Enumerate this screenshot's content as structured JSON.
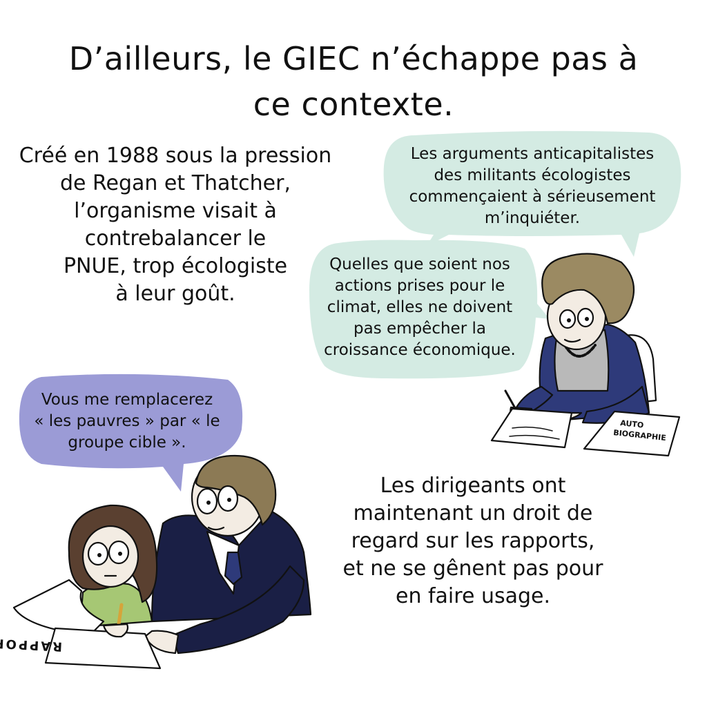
{
  "title": {
    "line1": "D’ailleurs, le GIEC n’échappe pas à",
    "line2": "ce contexte."
  },
  "narration_top": {
    "lines": [
      "Créé en 1988 sous la pression",
      "de Regan et Thatcher,",
      "l’organisme visait à",
      "contrebalancer le",
      "PNUE, trop écologiste",
      "à leur goût."
    ]
  },
  "bubble_thatcher_1": {
    "lines": [
      "Les arguments anticapitalistes",
      "des militants écologistes",
      "commençaient à sérieusement",
      "m’inquiéter."
    ],
    "color": "#d4ebe3"
  },
  "bubble_thatcher_2": {
    "lines": [
      "Quelles que soient nos",
      "actions prises pour le",
      "climat, elles ne doivent",
      "pas empêcher la",
      "croissance économique."
    ],
    "color": "#d4ebe3"
  },
  "bubble_man": {
    "lines": [
      "Vous me remplacerez",
      "« les pauvres » par « le",
      "groupe cible »."
    ],
    "color": "#9b9bd6"
  },
  "narration_bottom": {
    "lines": [
      "Les dirigeants ont",
      "maintenant un droit de",
      "regard sur les rapports,",
      "et ne se gênent pas pour",
      "en faire usage."
    ]
  },
  "paper_autobiographie": {
    "line1": "AUTO",
    "line2": "BIOGRAPHIE"
  },
  "paper_rapport": {
    "text": "RAPPORT"
  },
  "colors": {
    "ink": "#111111",
    "hair_woman": "#9b8a62",
    "jacket_woman": "#2e3a7a",
    "sweater_woman": "#b9b9b9",
    "hair_man": "#8c7a55",
    "suit_man": "#1a1f45",
    "skin": "#f3ece3",
    "hair_girl": "#5a4030",
    "shirt_girl": "#a6c774"
  }
}
